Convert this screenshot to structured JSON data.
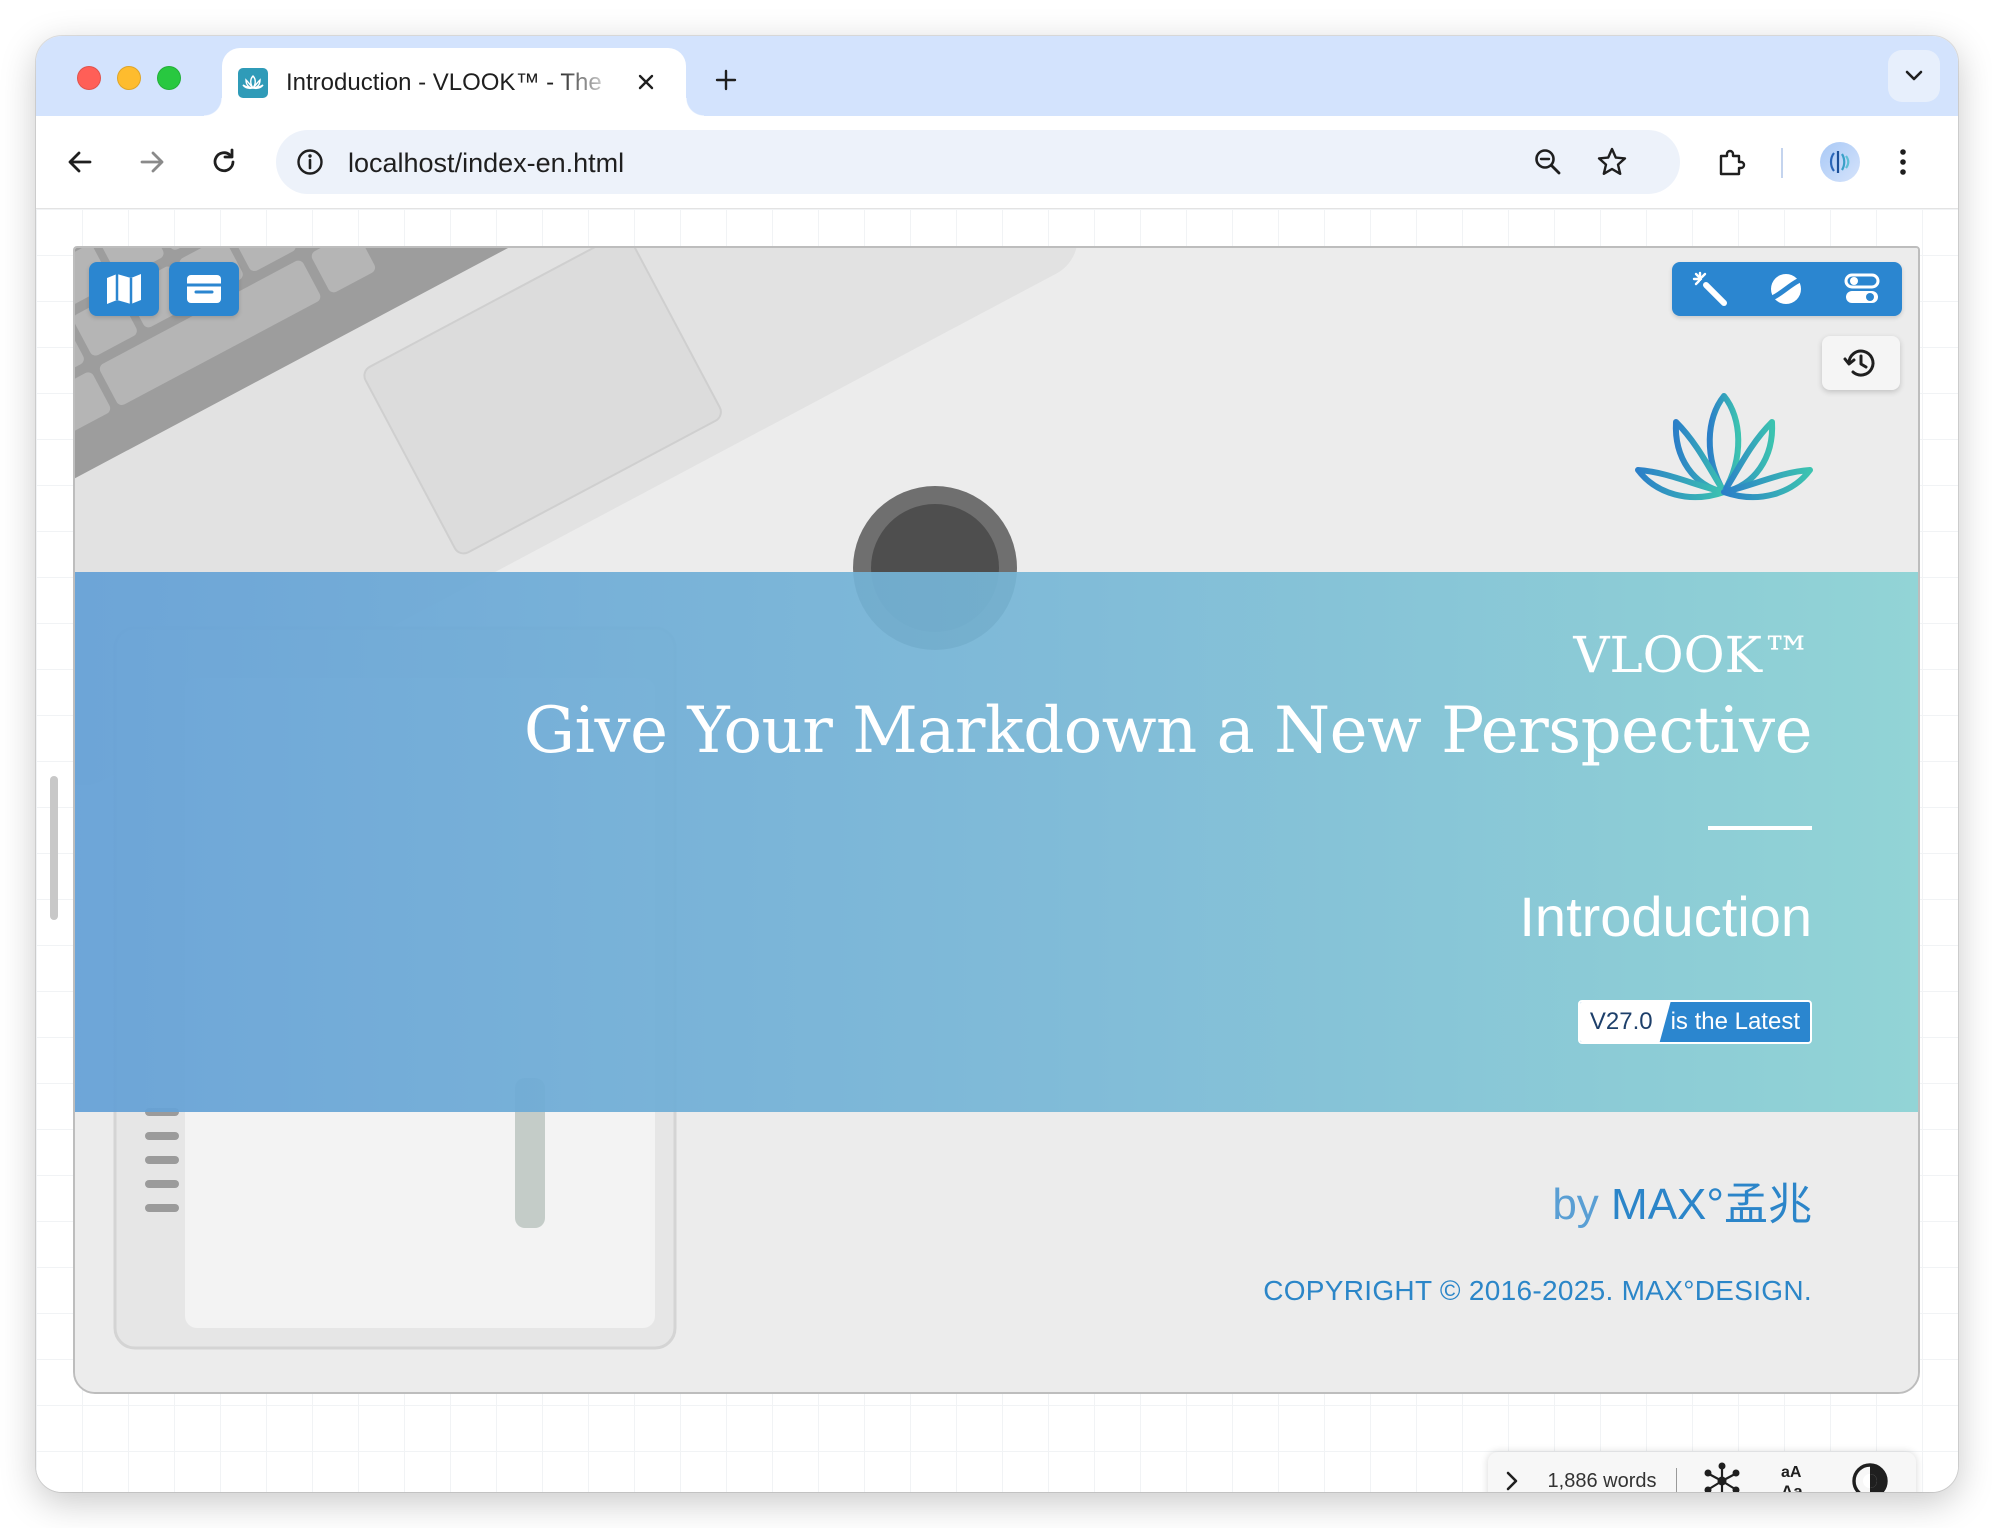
{
  "browser": {
    "tab": {
      "title": "Introduction - VLOOK™ - The",
      "favicon": "lotus-icon"
    },
    "new_tab_symbol": "+",
    "address": "localhost/index-en.html"
  },
  "page": {
    "title": "VLOOK™",
    "subtitle": "Give Your Markdown a New Perspective",
    "section": "Introduction",
    "badge": {
      "version": "V27.0",
      "status": "is the Latest"
    },
    "byline": {
      "prefix": "by",
      "author": "MAX°孟兆"
    },
    "copyright": "COPYRIGHT © 2016-2025. MAX°DESIGN."
  },
  "statusbar": {
    "word_count": "1,886 words",
    "font_toggle_label": "aA\nAa"
  },
  "colors": {
    "accent": "#2b86d0",
    "band_start": "#64a0d6",
    "band_end": "#8bd2d4",
    "byline_name": "#2b85c9"
  }
}
